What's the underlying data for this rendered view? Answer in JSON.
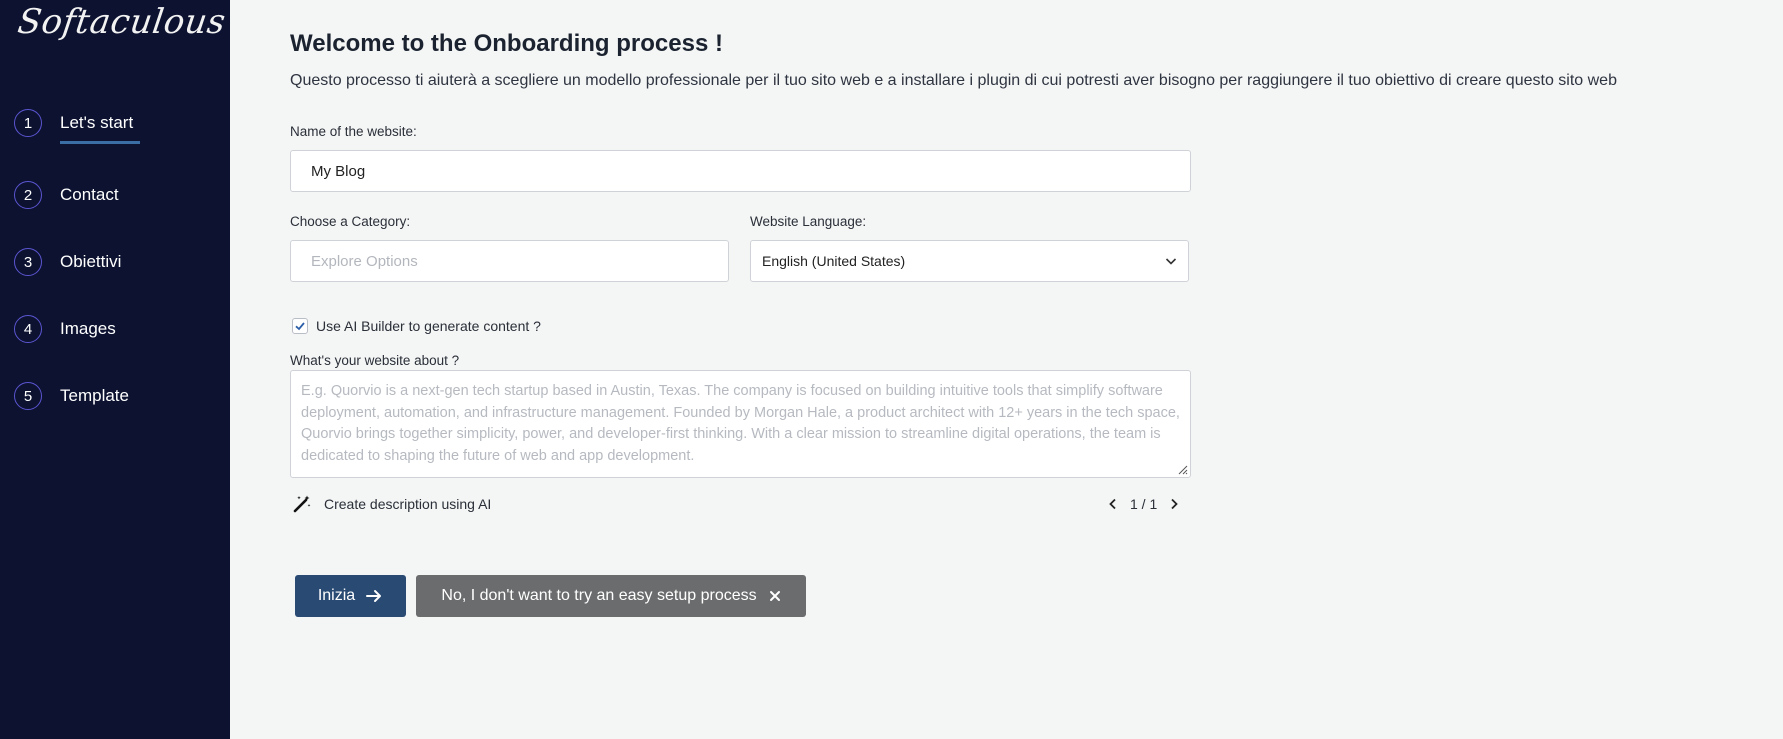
{
  "brand": {
    "logo_text": "Softaculous"
  },
  "sidebar": {
    "steps": [
      {
        "num": "1",
        "label": "Let's start"
      },
      {
        "num": "2",
        "label": "Contact"
      },
      {
        "num": "3",
        "label": "Obiettivi"
      },
      {
        "num": "4",
        "label": "Images"
      },
      {
        "num": "5",
        "label": "Template"
      }
    ],
    "active_step": 1
  },
  "main": {
    "title": "Welcome to the Onboarding process !",
    "subtitle": "Questo processo ti aiuterà a scegliere un modello professionale per il tuo sito web e a installare i plugin di cui potresti aver bisogno per raggiungere il tuo obiettivo di creare questo sito web",
    "website_name": {
      "label": "Name of the website:",
      "value": "My Blog"
    },
    "category": {
      "label": "Choose a Category:",
      "placeholder": "Explore Options"
    },
    "language": {
      "label": "Website Language:",
      "value": "English (United States)"
    },
    "ai_builder": {
      "label": "Use AI Builder to generate content ?",
      "checked": true
    },
    "about": {
      "label": "What's your website about ?",
      "placeholder": "E.g. Quorvio is a next-gen tech startup based in Austin, Texas. The company is focused on building intuitive tools that simplify software deployment, automation, and infrastructure management. Founded by Morgan Hale, a product architect with 12+ years in the tech space, Quorvio brings together simplicity, power, and developer-first thinking. With a clear mission to streamline digital operations, the team is dedicated to shaping the future of web and app development."
    },
    "ai_description": {
      "label": "Create description using AI",
      "icon": "magic-wand-icon"
    },
    "pager": {
      "text": "1 / 1"
    },
    "buttons": {
      "start": "Inizia",
      "skip": "No, I don't want to try an easy setup process"
    }
  },
  "colors": {
    "sidebar_bg": "#0c1230",
    "primary_button": "#284a73",
    "secondary_button": "#6b6c6d",
    "page_bg": "#f4f5f5"
  }
}
